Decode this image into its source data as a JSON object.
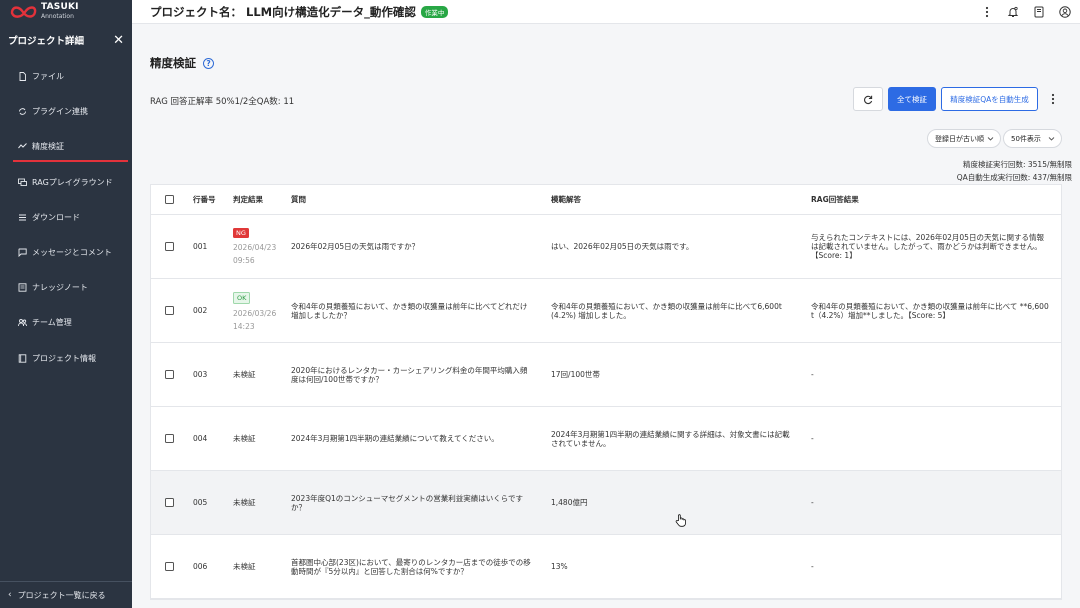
{
  "brand": {
    "line1": "TASUKI",
    "line2": "Annotation",
    "mark_color": "#e3323b"
  },
  "sidebar": {
    "header": "プロジェクト詳細",
    "items": [
      {
        "label": "ファイル",
        "icon": "file-icon"
      },
      {
        "label": "プラグイン連携",
        "icon": "plugin-icon"
      },
      {
        "label": "精度検証",
        "icon": "accuracy-icon",
        "active": true
      },
      {
        "label": "RAGプレイグラウンド",
        "icon": "chat-icon"
      },
      {
        "label": "ダウンロード",
        "icon": "download-icon"
      },
      {
        "label": "メッセージとコメント",
        "icon": "message-icon"
      },
      {
        "label": "ナレッジノート",
        "icon": "note-icon"
      },
      {
        "label": "チーム管理",
        "icon": "team-icon"
      },
      {
        "label": "プロジェクト情報",
        "icon": "project-info-icon"
      }
    ],
    "back_label": "プロジェクト一覧に戻る"
  },
  "header": {
    "title": "プロジェクト名： LLM向け構造化データ_動作確認",
    "status_badge": "作業中"
  },
  "page": {
    "title": "精度検証",
    "summary": "RAG 回答正解率 50%1/2全QA数: 11",
    "verify_all_label": "全て検証",
    "auto_generate_label": "精度検証QAを自動生成",
    "sort_select": "登録日が古い順",
    "page_size_select": "50件表示",
    "verify_count": "精度検証実行回数: 3515/無制限",
    "qa_generation_count": "QA自動生成実行回数: 437/無制限"
  },
  "table": {
    "headers": {
      "line_no": "行番号",
      "result": "判定結果",
      "question": "質問",
      "model_answer": "模範解答",
      "rag_result": "RAG回答結果"
    },
    "rows": [
      {
        "no": "001",
        "status": "NG",
        "date": "2026/04/23",
        "time": "09:56",
        "question": "2026年02月05日の天気は雨ですか？",
        "answer": "はい、2026年02月05日の天気は雨です。",
        "rag": "与えられたコンテキストには、2026年02月05日の天気に関する情報は記載されていません。したがって、雨かどうかは判断できません。【Score: 1】"
      },
      {
        "no": "002",
        "status": "OK",
        "date": "2026/03/26",
        "time": "14:23",
        "question": "令和4年の貝類養殖において、かき類の収獲量は前年に比べてどれだけ増加しましたか？",
        "answer": "令和4年の貝類養殖において、かき類の収獲量は前年に比べて6,600t (4.2%) 増加しました。",
        "rag": "令和4年の貝類養殖において、かき類の収獲量は前年に比べて **6,600 t（4.2%）増加**しました。【Score: 5】"
      },
      {
        "no": "003",
        "status_text": "未検証",
        "question": "2020年におけるレンタカー・カーシェアリング料金の年間平均購入頻度は何回/100世帯ですか？",
        "answer": "17回/100世帯",
        "rag": "-"
      },
      {
        "no": "004",
        "status_text": "未検証",
        "question": "2024年3月期第1四半期の連結業績について教えてください。",
        "answer": "2024年3月期第1四半期の連結業績に関する詳細は、対象文書には記載されていません。",
        "rag": "-"
      },
      {
        "no": "005",
        "status_text": "未検証",
        "question": "2023年度Q1のコンシューマセグメントの営業利益実績はいくらですか？",
        "answer": "1,480億円",
        "rag": "-"
      },
      {
        "no": "006",
        "status_text": "未検証",
        "question": "首都圏中心部(23区)において、最寄りのレンタカー店までの徒歩での移動時間が『5分以内』と回答した割合は何%ですか？",
        "answer": "13%",
        "rag": "-"
      }
    ]
  },
  "colors": {
    "sidebar_bg": "#2b3441",
    "primary": "#2d6be4",
    "ng": "#e03838",
    "ok": "#2e9b45",
    "active_underline": "#e3323b",
    "badge": "#28a745"
  }
}
